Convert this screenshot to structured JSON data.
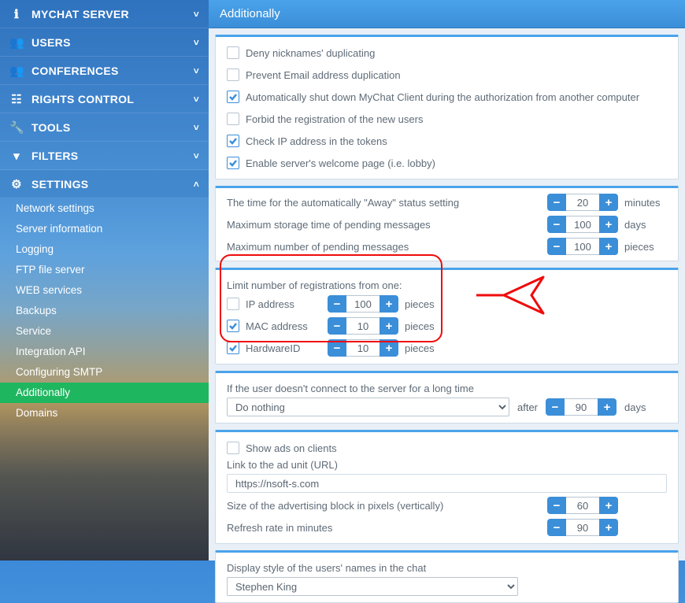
{
  "sidebar": {
    "items": [
      {
        "icon": "ℹ",
        "label": "MYCHAT SERVER",
        "chev": "˅"
      },
      {
        "icon": "👥",
        "label": "USERS",
        "chev": "˅"
      },
      {
        "icon": "👥",
        "label": "CONFERENCES",
        "chev": "˅"
      },
      {
        "icon": "☷",
        "label": "RIGHTS CONTROL",
        "chev": "˅"
      },
      {
        "icon": "🔧",
        "label": "TOOLS",
        "chev": "˅"
      },
      {
        "icon": "▾",
        "label": "FILTERS",
        "chev": "˅"
      },
      {
        "icon": "⚙",
        "label": "SETTINGS",
        "chev": "˄"
      }
    ],
    "sub_items": [
      "Network settings",
      "Server information",
      "Logging",
      "FTP file server",
      "WEB services",
      "Backups",
      "Service",
      "Integration API",
      "Configuring SMTP",
      "Additionally",
      "Domains"
    ],
    "active_sub": "Additionally"
  },
  "header": {
    "title": "Additionally"
  },
  "security": {
    "deny_dup": "Deny nicknames' duplicating",
    "prevent_email": "Prevent Email address duplication",
    "auto_shutdown": "Automatically shut down MyChat Client during the authorization from another computer",
    "forbid_reg": "Forbid the registration of the new users",
    "check_ip": "Check IP address in the tokens",
    "enable_lobby": "Enable server's welcome page (i.e. lobby)"
  },
  "timing": {
    "away_label": "The time for the automatically \"Away\" status setting",
    "away_value": "20",
    "away_unit": "minutes",
    "storage_label": "Maximum storage time of pending messages",
    "storage_value": "100",
    "storage_unit": "days",
    "maxpend_label": "Maximum number of pending messages",
    "maxpend_value": "100",
    "maxpend_unit": "pieces"
  },
  "reglimit": {
    "title": "Limit number of registrations from one:",
    "ip_label": "IP address",
    "ip_value": "100",
    "ip_unit": "pieces",
    "mac_label": "MAC address",
    "mac_value": "10",
    "mac_unit": "pieces",
    "hw_label": "HardwareID",
    "hw_value": "10",
    "hw_unit": "pieces"
  },
  "idle": {
    "label": "If the user doesn't connect to the server for a long time",
    "action": "Do nothing",
    "after_label": "after",
    "value": "90",
    "unit": "days"
  },
  "ads": {
    "show_label": "Show ads on clients",
    "link_label": "Link to the ad unit (URL)",
    "link_value": "https://nsoft-s.com",
    "size_label": "Size of the advertising block in pixels (vertically)",
    "size_value": "60",
    "refresh_label": "Refresh rate in minutes",
    "refresh_value": "90"
  },
  "display": {
    "label": "Display style of the users' names in the chat",
    "value": "Stephen King"
  }
}
